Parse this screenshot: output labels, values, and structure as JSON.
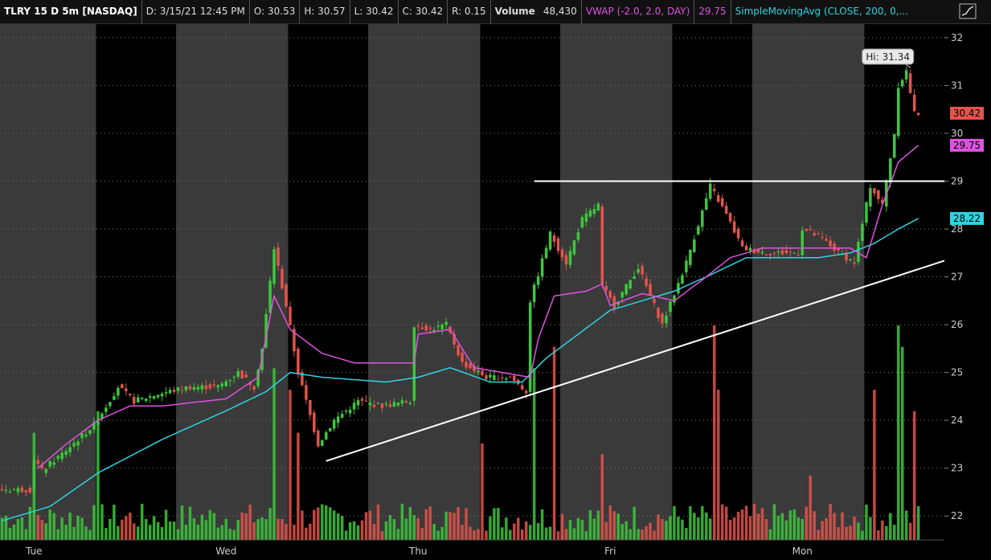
{
  "header": {
    "symbol": "TLRY 15 D 5m [NASDAQ]",
    "date": "D: 3/15/21 12:45 PM",
    "open": "O: 30.53",
    "high": "H: 30.57",
    "low": "L: 30.42",
    "close": "C: 30.42",
    "range": "R: 0.15",
    "volume_label": "Volume",
    "volume_value": "48,430",
    "vwap_label": "VWAP (-2.0, 2.0, DAY)",
    "vwap_value": "29.75",
    "sma_label": "SimpleMovingAvg (CLOSE, 200, 0,..."
  },
  "colors": {
    "up": "#3bc93b",
    "down": "#e5534b",
    "vwap": "#e052e0",
    "sma": "#2ed4df",
    "trend": "#ffffff",
    "afterhours_band": "#3a3a3a",
    "session_band": "#000000"
  },
  "chart_data": {
    "type": "candlestick",
    "ylim": [
      21.5,
      32.3
    ],
    "y_ticks": [
      22,
      23,
      24,
      25,
      26,
      27,
      28,
      29,
      30,
      31,
      32
    ],
    "x_labels": [
      {
        "label": "Tue",
        "bar": 8
      },
      {
        "label": "Wed",
        "bar": 56
      },
      {
        "label": "Thu",
        "bar": 104
      },
      {
        "label": "Fri",
        "bar": 152
      },
      {
        "label": "Mon",
        "bar": 200
      }
    ],
    "session_segments": [
      {
        "start": 0,
        "end": 24,
        "type": "ah"
      },
      {
        "start": 24,
        "end": 44,
        "type": "s"
      },
      {
        "start": 44,
        "end": 72,
        "type": "ah"
      },
      {
        "start": 72,
        "end": 92,
        "type": "s"
      },
      {
        "start": 92,
        "end": 120,
        "type": "ah"
      },
      {
        "start": 120,
        "end": 140,
        "type": "s"
      },
      {
        "start": 140,
        "end": 168,
        "type": "ah"
      },
      {
        "start": 168,
        "end": 188,
        "type": "s"
      },
      {
        "start": 188,
        "end": 216,
        "type": "ah"
      },
      {
        "start": 216,
        "end": 236,
        "type": "s"
      }
    ],
    "n_bars": 230,
    "price_anchors": [
      [
        0,
        22.55
      ],
      [
        8,
        22.55
      ],
      [
        9,
        23.2
      ],
      [
        11,
        22.95
      ],
      [
        16,
        23.3
      ],
      [
        20,
        23.6
      ],
      [
        24,
        23.9
      ],
      [
        30,
        24.7
      ],
      [
        34,
        24.4
      ],
      [
        40,
        24.55
      ],
      [
        48,
        24.7
      ],
      [
        55,
        24.7
      ],
      [
        60,
        25.0
      ],
      [
        64,
        24.7
      ],
      [
        66,
        25.5
      ],
      [
        69,
        27.6
      ],
      [
        72,
        26.4
      ],
      [
        75,
        25.0
      ],
      [
        80,
        23.5
      ],
      [
        84,
        24.0
      ],
      [
        90,
        24.4
      ],
      [
        96,
        24.3
      ],
      [
        103,
        24.4
      ],
      [
        104,
        26.0
      ],
      [
        108,
        25.9
      ],
      [
        112,
        26.0
      ],
      [
        116,
        25.2
      ],
      [
        122,
        24.9
      ],
      [
        128,
        24.9
      ],
      [
        132,
        24.6
      ],
      [
        133,
        26.5
      ],
      [
        138,
        27.9
      ],
      [
        142,
        27.3
      ],
      [
        146,
        28.2
      ],
      [
        150,
        28.5
      ],
      [
        151,
        26.8
      ],
      [
        154,
        26.4
      ],
      [
        160,
        27.2
      ],
      [
        166,
        26.0
      ],
      [
        172,
        27.3
      ],
      [
        178,
        28.9
      ],
      [
        182,
        28.3
      ],
      [
        186,
        27.6
      ],
      [
        192,
        27.5
      ],
      [
        200,
        27.5
      ],
      [
        201,
        28.0
      ],
      [
        206,
        27.8
      ],
      [
        210,
        27.5
      ],
      [
        214,
        27.3
      ],
      [
        218,
        28.9
      ],
      [
        221,
        28.5
      ],
      [
        224,
        30.0
      ],
      [
        225,
        31.0
      ],
      [
        227,
        31.3
      ],
      [
        229,
        30.42
      ]
    ],
    "vwap_anchors": [
      [
        9,
        23.0
      ],
      [
        16,
        23.5
      ],
      [
        24,
        24.0
      ],
      [
        32,
        24.3
      ],
      [
        40,
        24.3
      ],
      [
        56,
        24.45
      ],
      [
        64,
        24.9
      ],
      [
        68,
        26.6
      ],
      [
        72,
        25.9
      ],
      [
        80,
        25.4
      ],
      [
        88,
        25.2
      ],
      [
        103,
        25.2
      ],
      [
        104,
        25.8
      ],
      [
        112,
        25.9
      ],
      [
        118,
        25.1
      ],
      [
        132,
        24.9
      ],
      [
        134,
        25.7
      ],
      [
        138,
        26.6
      ],
      [
        146,
        26.7
      ],
      [
        150,
        26.85
      ],
      [
        152,
        26.4
      ],
      [
        160,
        26.65
      ],
      [
        168,
        26.5
      ],
      [
        176,
        27.0
      ],
      [
        182,
        27.4
      ],
      [
        190,
        27.6
      ],
      [
        200,
        27.6
      ],
      [
        204,
        27.6
      ],
      [
        212,
        27.6
      ],
      [
        216,
        27.4
      ],
      [
        220,
        28.5
      ],
      [
        224,
        29.4
      ],
      [
        229,
        29.75
      ]
    ],
    "sma_anchors": [
      [
        0,
        21.9
      ],
      [
        12,
        22.2
      ],
      [
        24,
        22.9
      ],
      [
        40,
        23.6
      ],
      [
        56,
        24.2
      ],
      [
        66,
        24.6
      ],
      [
        72,
        25.0
      ],
      [
        80,
        24.9
      ],
      [
        96,
        24.8
      ],
      [
        104,
        24.9
      ],
      [
        112,
        25.1
      ],
      [
        122,
        24.8
      ],
      [
        130,
        24.8
      ],
      [
        136,
        25.3
      ],
      [
        144,
        25.8
      ],
      [
        152,
        26.3
      ],
      [
        160,
        26.5
      ],
      [
        168,
        26.7
      ],
      [
        176,
        27.0
      ],
      [
        186,
        27.4
      ],
      [
        196,
        27.4
      ],
      [
        204,
        27.4
      ],
      [
        212,
        27.5
      ],
      [
        218,
        27.7
      ],
      [
        224,
        28.0
      ],
      [
        229,
        28.22
      ]
    ],
    "horizontal_line": {
      "price": 29.0,
      "from_bar": 133
    },
    "trendline": {
      "from": [
        81,
        23.15
      ],
      "to": [
        236,
        27.35
      ]
    },
    "volume_spikes": [
      [
        8,
        0.5
      ],
      [
        24,
        0.6
      ],
      [
        68,
        0.8
      ],
      [
        72,
        0.7
      ],
      [
        74,
        0.5
      ],
      [
        120,
        0.45
      ],
      [
        133,
        0.8
      ],
      [
        138,
        0.9
      ],
      [
        150,
        0.4
      ],
      [
        178,
        1.0
      ],
      [
        179,
        0.7
      ],
      [
        202,
        0.3
      ],
      [
        218,
        0.7
      ],
      [
        224,
        1.0
      ],
      [
        225,
        0.9
      ],
      [
        228,
        0.6
      ]
    ],
    "annotations": {
      "hi_label": "Hi: 31.34",
      "hi_bar": 227,
      "hi_price": 31.34
    },
    "price_labels": [
      {
        "text": "30.42",
        "price": 30.42,
        "color": "#e5534b"
      },
      {
        "text": "29.75",
        "price": 29.75,
        "color": "#e052e0"
      },
      {
        "text": "28.22",
        "price": 28.22,
        "color": "#2ed4df"
      }
    ]
  }
}
